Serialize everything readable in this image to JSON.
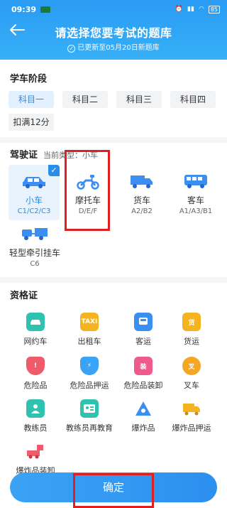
{
  "status_bar": {
    "time": "09:39",
    "battery": "85"
  },
  "header": {
    "title": "请选择您要考试的题库",
    "subtitle": "已更新至05月20日新题库"
  },
  "stage": {
    "title": "学车阶段",
    "options": [
      "科目一",
      "科目二",
      "科目三",
      "科目四",
      "扣满12分"
    ],
    "selected": "科目一"
  },
  "license": {
    "title": "驾驶证",
    "current_type": "当前类型：小车",
    "vehicles": [
      {
        "name": "小车",
        "sub": "C1/C2/C3",
        "icon": "car-icon",
        "selected": true
      },
      {
        "name": "摩托车",
        "sub": "D/E/F",
        "icon": "motorcycle-icon",
        "selected": false
      },
      {
        "name": "货车",
        "sub": "A2/B2",
        "icon": "truck-icon",
        "selected": false
      },
      {
        "name": "客车",
        "sub": "A1/A3/B1",
        "icon": "bus-icon",
        "selected": false
      },
      {
        "name": "轻型牵引挂车",
        "sub": "C6",
        "icon": "trailer-icon",
        "selected": false
      }
    ]
  },
  "qualification": {
    "title": "资格证",
    "items": [
      {
        "name": "网约车",
        "icon": "ride-hailing-icon",
        "color": "#2fc2b0"
      },
      {
        "name": "出租车",
        "icon": "taxi-icon",
        "color": "#f5b31f",
        "glyph": "TAXI"
      },
      {
        "name": "客运",
        "icon": "passenger-bus-icon",
        "color": "#3b8ff2"
      },
      {
        "name": "货运",
        "icon": "freight-icon",
        "color": "#f5b31f",
        "glyph": "货"
      },
      {
        "name": "危险品",
        "icon": "danger-shield-icon",
        "color": "#f05a6a",
        "glyph": "!"
      },
      {
        "name": "危险品押运",
        "icon": "lightning-shield-icon",
        "color": "#3aa3f5",
        "glyph": "⚡"
      },
      {
        "name": "危险品装卸",
        "icon": "load-icon",
        "color": "#f05a8a",
        "glyph": "装"
      },
      {
        "name": "叉车",
        "icon": "forklift-icon",
        "color": "#f5a623",
        "glyph": "叉"
      },
      {
        "name": "教练员",
        "icon": "instructor-icon",
        "color": "#2fc2b0"
      },
      {
        "name": "教练员再教育",
        "icon": "instructor-card-icon",
        "color": "#2fc2b0"
      },
      {
        "name": "爆炸品",
        "icon": "explosive-icon",
        "color": "#3b8ff2"
      },
      {
        "name": "爆炸品押运",
        "icon": "explosive-truck-icon",
        "color": "#f5b31f"
      },
      {
        "name": "爆炸品装卸",
        "icon": "explosive-load-icon",
        "color": "#f05a6a"
      }
    ]
  },
  "confirm_label": "确定"
}
